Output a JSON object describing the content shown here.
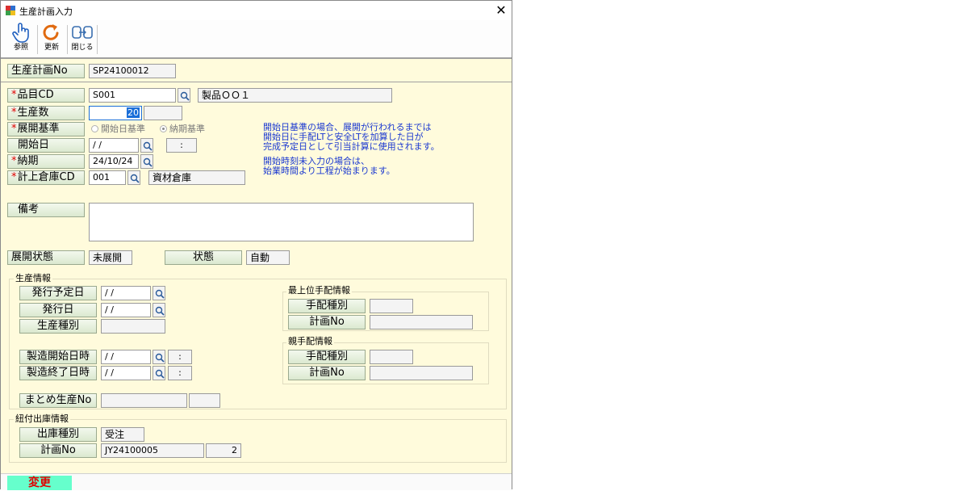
{
  "window": {
    "title": "生産計画入力",
    "close_glyph": "✕"
  },
  "toolbar": {
    "reference": "参照",
    "update": "更新",
    "close": "閉じる"
  },
  "plan_no": {
    "label": "生産計画No",
    "value": "SP24100012"
  },
  "item": {
    "req": "*",
    "label": "品目CD",
    "code": "S001",
    "name": "製品ＯＯ１"
  },
  "qty": {
    "req": "*",
    "label": "生産数",
    "value": "20",
    "unit": ""
  },
  "expand_basis": {
    "req": "*",
    "label": "展開基準",
    "options": [
      "開始日基準",
      "納期基準"
    ],
    "selected": "納期基準"
  },
  "start_date": {
    "label": "開始日",
    "date": "/ /",
    "time": ":"
  },
  "due_date": {
    "req": "*",
    "label": "納期",
    "value": "24/10/24"
  },
  "warehouse": {
    "req": "*",
    "label": "計上倉庫CD",
    "code": "001",
    "name": "資材倉庫"
  },
  "remarks": {
    "label": "備考",
    "value": ""
  },
  "info_note": {
    "line1": "開始日基準の場合、展開が行われるまでは",
    "line2": "開始日に手配LTと安全LTを加算した日が",
    "line3": "完成予定日として引当計算に使用されます。",
    "line4": "開始時刻未入力の場合は、",
    "line5": "始業時間より工程が始まります。"
  },
  "expand_status": {
    "label": "展開状態",
    "value": "未展開"
  },
  "status": {
    "label": "状態",
    "value": "自動"
  },
  "production_info": {
    "title": "生産情報",
    "issue_plan_date": {
      "label": "発行予定日",
      "value": "/ /"
    },
    "issue_date": {
      "label": "発行日",
      "value": "/ /"
    },
    "production_type": {
      "label": "生産種別",
      "value": ""
    },
    "mfg_start": {
      "label": "製造開始日時",
      "date": "/ /",
      "time": ":"
    },
    "mfg_end": {
      "label": "製造終了日時",
      "date": "/ /",
      "time": ":"
    },
    "batch_no": {
      "label": "まとめ生産No",
      "value": "",
      "sub": ""
    }
  },
  "top_arrangement": {
    "title": "最上位手配情報",
    "type_label": "手配種別",
    "type_value": "",
    "plan_label": "計画No",
    "plan_value": ""
  },
  "parent_arrangement": {
    "title": "親手配情報",
    "type_label": "手配種別",
    "type_value": "",
    "plan_label": "計画No",
    "plan_value": ""
  },
  "shipping_info": {
    "title": "紐付出庫情報",
    "type_label": "出庫種別",
    "type_value": "受注",
    "plan_label": "計画No",
    "plan_value": "JY24100005",
    "line_no": "2"
  },
  "mode": {
    "value": "変更"
  }
}
